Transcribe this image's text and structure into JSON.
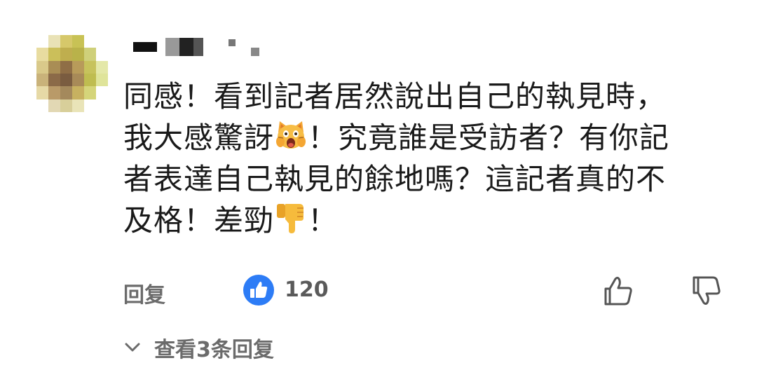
{
  "comment": {
    "lines": [
      [
        "同感！看到記者居然說出自己的執見時，"
      ],
      [
        "我大感驚訝",
        "！究竟誰是受訪者？有你記"
      ],
      [
        "者表達自己執見的餘地嗎？這記者真的不"
      ],
      [
        "及格！差勁",
        "！"
      ]
    ],
    "emojis": [
      "scream-cat-emoji",
      "thumbs-down-emoji"
    ]
  },
  "actions": {
    "reply_label": "回复",
    "like_count": "120",
    "like_icon": "like-badge-icon",
    "upvote_icon": "thumb-up-icon",
    "downvote_icon": "thumb-down-icon"
  },
  "view_replies": {
    "label": "查看3条回复",
    "icon": "chevron-down-icon"
  },
  "colors": {
    "text": "#1a1a1a",
    "muted": "#6b6b6b",
    "like_blue": "#2d7cf6",
    "emoji_yellow": "#f5b836"
  }
}
